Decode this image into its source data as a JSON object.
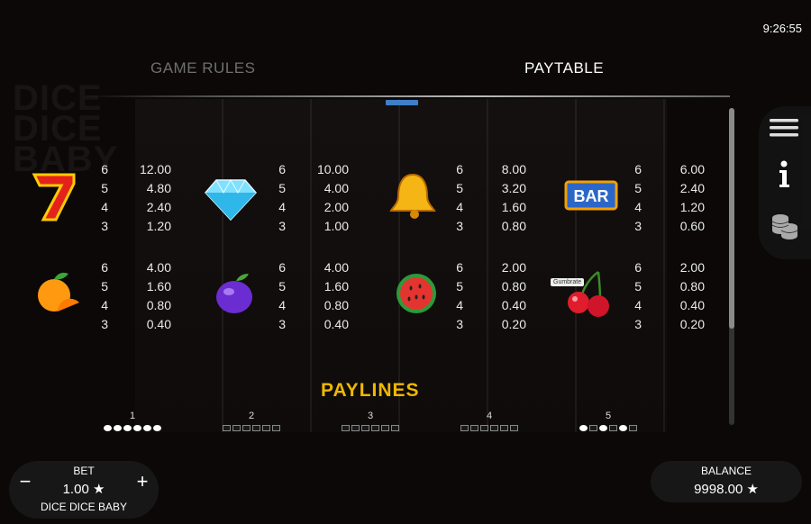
{
  "clock": "9:26:55",
  "tabs": {
    "rules": "GAME RULES",
    "paytable": "PAYTABLE"
  },
  "paytable": [
    {
      "symbol": "seven-icon",
      "rows": [
        [
          "6",
          "12.00"
        ],
        [
          "5",
          "4.80"
        ],
        [
          "4",
          "2.40"
        ],
        [
          "3",
          "1.20"
        ]
      ]
    },
    {
      "symbol": "diamond-icon",
      "rows": [
        [
          "6",
          "10.00"
        ],
        [
          "5",
          "4.00"
        ],
        [
          "4",
          "2.00"
        ],
        [
          "3",
          "1.00"
        ]
      ]
    },
    {
      "symbol": "bell-icon",
      "rows": [
        [
          "6",
          "8.00"
        ],
        [
          "5",
          "3.20"
        ],
        [
          "4",
          "1.60"
        ],
        [
          "3",
          "0.80"
        ]
      ]
    },
    {
      "symbol": "bar-icon",
      "rows": [
        [
          "6",
          "6.00"
        ],
        [
          "5",
          "2.40"
        ],
        [
          "4",
          "1.20"
        ],
        [
          "3",
          "0.60"
        ]
      ]
    },
    {
      "symbol": "orange-icon",
      "rows": [
        [
          "6",
          "4.00"
        ],
        [
          "5",
          "1.60"
        ],
        [
          "4",
          "0.80"
        ],
        [
          "3",
          "0.40"
        ]
      ]
    },
    {
      "symbol": "plum-icon",
      "rows": [
        [
          "6",
          "4.00"
        ],
        [
          "5",
          "1.60"
        ],
        [
          "4",
          "0.80"
        ],
        [
          "3",
          "0.40"
        ]
      ]
    },
    {
      "symbol": "watermelon-icon",
      "rows": [
        [
          "6",
          "2.00"
        ],
        [
          "5",
          "0.80"
        ],
        [
          "4",
          "0.40"
        ],
        [
          "3",
          "0.20"
        ]
      ]
    },
    {
      "symbol": "cherry-icon",
      "rows": [
        [
          "6",
          "2.00"
        ],
        [
          "5",
          "0.80"
        ],
        [
          "4",
          "0.40"
        ],
        [
          "3",
          "0.20"
        ]
      ]
    }
  ],
  "bar_symbol_text": "BAR",
  "tooltip": "Gumbrate",
  "paylines_title": "PAYLINES",
  "paylines": [
    "1",
    "2",
    "3",
    "4",
    "5"
  ],
  "bet": {
    "label": "BET",
    "value": "1.00 ★",
    "minus": "−",
    "plus": "+",
    "game": "DICE DICE BABY"
  },
  "balance": {
    "label": "BALANCE",
    "value": "9998.00 ★"
  },
  "colors": {
    "accent": "#f0b800",
    "tab_indicator": "#3f7fc9"
  }
}
